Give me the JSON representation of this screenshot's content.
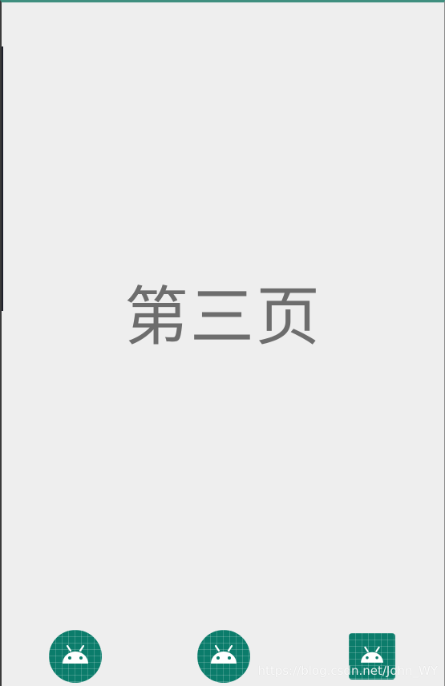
{
  "page": {
    "title": "第三页"
  },
  "bottom_nav": {
    "items": [
      {
        "icon": "android-icon",
        "shape": "round"
      },
      {
        "icon": "android-icon",
        "shape": "round"
      },
      {
        "icon": "android-icon",
        "shape": "square"
      }
    ]
  },
  "watermark": {
    "text": "https://blog.csdn.net/John_WY"
  },
  "colors": {
    "background": "#eeeeee",
    "accent": "#0b7c6b",
    "title_text": "#6d6d6d",
    "top_border": "#3f8f7f"
  }
}
